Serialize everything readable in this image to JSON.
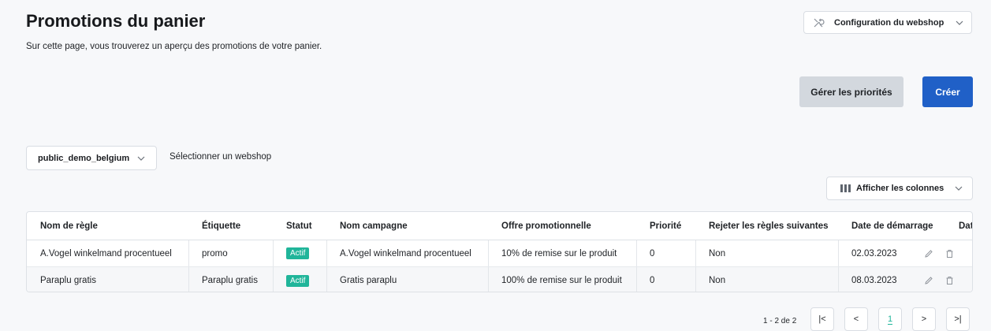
{
  "header": {
    "title": "Promotions du panier",
    "subtitle": "Sur cette page, vous trouverez un aperçu des promotions de votre panier.",
    "webshop_config_label": "Configuration du webshop"
  },
  "actions": {
    "manage_priorities_label": "Gérer les priorités",
    "create_label": "Créer"
  },
  "filters": {
    "webshop_value": "public_demo_belgium",
    "webshop_label": "Sélectionner un webshop",
    "columns_label": "Afficher les colonnes"
  },
  "table": {
    "columns": [
      "Nom de règle",
      "Étiquette",
      "Statut",
      "Nom campagne",
      "Offre promotionnelle",
      "Priorité",
      "Rejeter les règles suivantes",
      "Date de démarrage",
      "Dat"
    ],
    "rows": [
      [
        "A.Vogel winkelmand procentueel",
        "promo",
        "Actif",
        "A.Vogel winkelmand procentueel",
        "10% de remise sur le produit",
        "0",
        "Non",
        "02.03.2023"
      ],
      [
        "Paraplu gratis",
        "Paraplu gratis",
        "Actif",
        "Gratis paraplu",
        "100% de remise sur le produit",
        "0",
        "Non",
        "08.03.2023"
      ]
    ]
  },
  "pagination": {
    "range_text": "1 - 2 de 2",
    "first": "|<",
    "prev": "<",
    "current": "1",
    "next": ">",
    "last": ">|"
  },
  "colors": {
    "primary": "#2060c7",
    "active_badge": "#20b59a",
    "secondary_button": "#d3d8de"
  }
}
